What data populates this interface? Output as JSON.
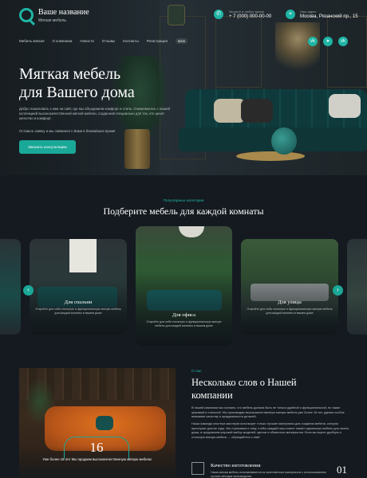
{
  "brand": {
    "title": "Ваше название",
    "subtitle": "Мягкая мебель",
    "accent": "#1fb5a5"
  },
  "contacts": {
    "phone_label": "Звоните в любое время",
    "phone": "+ 7 (000) 000-00-00",
    "address_label": "Наш адрес",
    "address": "Москва, Рязанский пр., 15",
    "phone_icon": "phone-icon",
    "address_icon": "location-pin-icon"
  },
  "social": [
    "vk-icon",
    "telegram-icon",
    "vk-icon"
  ],
  "nav": {
    "items": [
      "Мебель мягкая",
      "О компании",
      "Новости",
      "Отзывы",
      "Контакты",
      "Регистрация"
    ],
    "badge": "8000"
  },
  "hero": {
    "title_line1": "Мягкая мебель",
    "title_line2": "для Вашего дома",
    "text1": "Добро пожаловать к нам на сайт, где мы объединили комфорт и стиль. Ознакомьтесь с нашей коллекцией высококачественной мягкой мебели, созданной специально для тех, кто ценит качество и комфорт.",
    "text2": "Оставьте заявку и мы свяжемся с Вами в ближайшее время",
    "button": "Заказать консультацию"
  },
  "categories": {
    "kicker": "Популярные категории",
    "title": "Подберите мебель для каждой комнаты",
    "prev_icon": "chevron-left-icon",
    "next_icon": "chevron-right-icon",
    "cards": [
      {
        "title": "Для спальни",
        "text": "Откройте для себя стильную и функциональную мягкую мебель для каждой комнаты в вашем доме"
      },
      {
        "title": "Для офиса",
        "text": "Откройте для себя стильную и функциональную мягкую мебель для каждой комнаты в вашем доме"
      },
      {
        "title": "Для улицы",
        "text": "Откройте для себя стильную и функциональную мягкую мебель для каждой комнаты в вашем доме"
      }
    ]
  },
  "about": {
    "kicker": "О нас",
    "title_line1": "Несколько слов о Нашей",
    "title_line2": "компании",
    "para1": "В нашей компании мы считаем, что мебель должна быть не только удобной и функциональной, но также красивой и стильной. Мы производим высококачественную мягкую мебель уже более 16 лет, уделяя особое внимание качеству и продуманности деталей.",
    "para2": "Наша команда опытных мастеров использует только лучшие материалы для создания мебели, которая прослужит долгие годы. Мы стремимся к тому, чтобы каждый наш клиент нашёл идеальную мебель для своего дома, и предлагаем широкий выбор моделей, цветов и обивочных материалов. Если вы ищете удобную и стильную мягкую мебель — обращайтесь к нам!",
    "counter": "16",
    "counter_caption": "Уже более 16 лет Мы продаем высококачественную мягкую мебель!",
    "feature_title": "Качество изготовления",
    "feature_text": "Наша мягкая мебель изготавливается из качественных материалов с использованием лучших методов производства",
    "feature_num": "01"
  }
}
